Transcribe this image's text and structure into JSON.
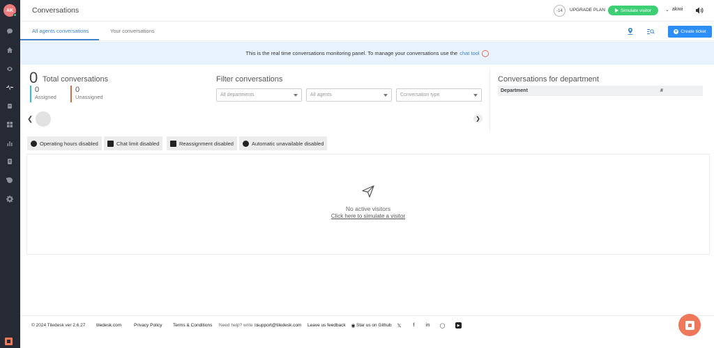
{
  "user": {
    "initials": "AK",
    "name": "akiwi"
  },
  "sidebar": {
    "items": [
      {
        "icon": "chat-bubble-icon"
      },
      {
        "icon": "home-icon"
      },
      {
        "icon": "eye-icon"
      },
      {
        "icon": "monitor-pulse-icon",
        "active": true
      },
      {
        "icon": "bot-icon"
      },
      {
        "icon": "apps-grid-icon"
      },
      {
        "icon": "analytics-bar-icon"
      },
      {
        "icon": "contacts-icon"
      },
      {
        "icon": "history-icon"
      },
      {
        "icon": "settings-gear-icon"
      }
    ]
  },
  "header": {
    "title": "Conversations",
    "trial_days": "-14",
    "upgrade_label": "UPGRADE PLAN",
    "simulate_label": "Simulate visitor"
  },
  "tabs": {
    "all": "All agents conversations",
    "yours": "Your conversations",
    "create_ticket": "Create ticket"
  },
  "banner": {
    "text": "This is the real time conversations monitoring panel. To manage your conversations use the",
    "link": "chat tool"
  },
  "stats": {
    "total": "0",
    "total_label": "Total conversations",
    "assigned": "0",
    "assigned_label": "Assigned",
    "unassigned": "0",
    "unassigned_label": "Unassigned"
  },
  "filters": {
    "title": "Filter conversations",
    "departments": "All departments",
    "agents": "All agents",
    "type": "Conversation type"
  },
  "departments": {
    "title": "Conversations for department",
    "col_department": "Department",
    "col_count": "#"
  },
  "badges": {
    "hours": "Operating hours disabled",
    "chat_limit": "Chat limit disabled",
    "reassignment": "Reassignment disabled",
    "auto_unavailable": "Automatic unavailable disabled"
  },
  "empty": {
    "title": "No active visitors",
    "link": "Click here to simulate a visitor"
  },
  "footer": {
    "copyright": "© 2024 Tiledesk ver 2.6.27",
    "site": "tiledesk.com",
    "privacy": "Privacy Policy",
    "terms": "Terms & Conditions",
    "help_prefix": "Need help? write to",
    "support_email": "support@tiledesk.com",
    "feedback": "Leave us feedback",
    "github": "Star us on Github",
    "social": [
      "x-icon",
      "facebook-icon",
      "linkedin-icon",
      "instagram-icon",
      "youtube-icon"
    ]
  },
  "colors": {
    "sidebar_bg": "#252a34",
    "accent": "#3f85ca",
    "simulate_green": "#3ccf73",
    "create_blue": "#2c8ef8",
    "banner_bg": "#e8f2fd",
    "assigned": "#30bcd4",
    "unassigned": "#e0654b",
    "brand_orange": "#f0785a"
  }
}
